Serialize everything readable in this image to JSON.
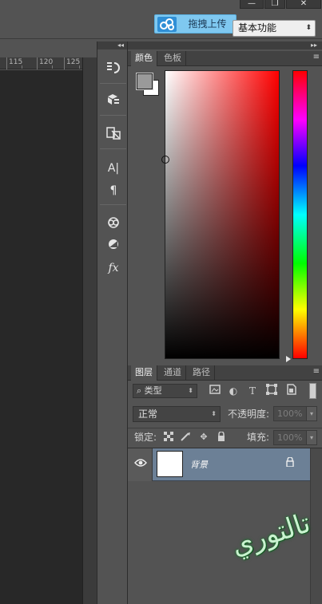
{
  "window": {
    "minimize_glyph": "—",
    "restore_glyph": "❐",
    "close_glyph": "✕"
  },
  "options_bar": {
    "upload_button": "拖拽上传",
    "workspace": "基本功能"
  },
  "ruler": {
    "ticks": [
      "115",
      "120",
      "125"
    ]
  },
  "strip_icons": [
    "history-icon",
    "properties-icon",
    "paragraph-styles-icon",
    "character-icon",
    "paragraph-icon",
    "libraries-icon",
    "adjustments-icon",
    "styles-icon"
  ],
  "color_panel": {
    "tabs": [
      "颜色",
      "色板"
    ],
    "active_tab": "颜色",
    "foreground": "#9a9a9a",
    "background": "#ffffff",
    "hue": "#ff0000"
  },
  "layers_panel": {
    "tabs": [
      "图层",
      "通道",
      "路径"
    ],
    "active_tab": "图层",
    "filter_label": "类型",
    "blend_mode": "正常",
    "opacity_label": "不透明度:",
    "opacity_value": "100%",
    "lock_label": "锁定:",
    "fill_label": "填充:",
    "fill_value": "100%",
    "layers": [
      {
        "name": "背景",
        "visible": true,
        "locked": true,
        "selected": true
      }
    ]
  },
  "watermark": {
    "text": "تالتوري"
  }
}
